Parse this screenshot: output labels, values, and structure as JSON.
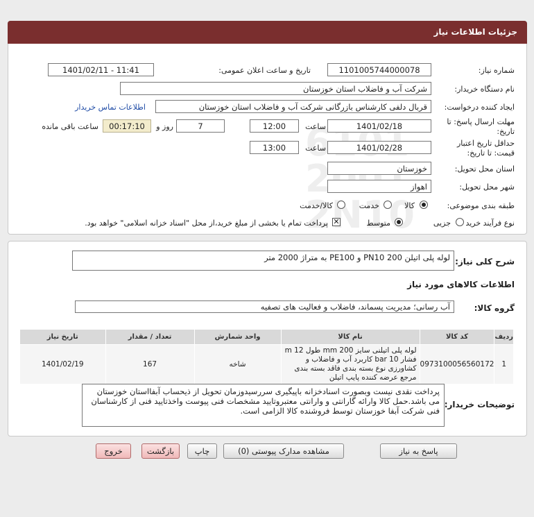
{
  "header": {
    "title": "جزئیات اطلاعات نیاز"
  },
  "form": {
    "need_number": {
      "label": "شماره نیاز:",
      "value": "1101005744000078"
    },
    "announce_datetime": {
      "label": "تاریخ و ساعت اعلان عمومی:",
      "value": "1401/02/11 - 11:41"
    },
    "buyer_org": {
      "label": "نام دستگاه خریدار:",
      "value": "شرکت آب و فاضلاب استان خوزستان"
    },
    "requester": {
      "label": "ایجاد کننده درخواست:",
      "value": "قربال دلفی کارشناس بازرگانی شرکت آب و فاضلاب استان خوزستان",
      "contact_link": "اطلاعات تماس خریدار"
    },
    "reply_deadline": {
      "label_line1": "مهلت ارسال پاسخ: تا",
      "label_line2": "تاریخ:",
      "date": "1401/02/18",
      "time_label": "ساعت",
      "time": "12:00",
      "days": "7",
      "days_label": "روز و",
      "remaining": "00:17:10",
      "remaining_label": "ساعت باقی مانده"
    },
    "price_validity": {
      "label_line1": "حداقل تاریخ اعتبار",
      "label_line2": "قیمت: تا تاریخ:",
      "date": "1401/02/28",
      "time_label": "ساعت",
      "time": "13:00"
    },
    "delivery_province": {
      "label": "استان محل تحویل:",
      "value": "خوزستان"
    },
    "delivery_city": {
      "label": "شهر محل تحویل:",
      "value": "اهواز"
    },
    "category": {
      "label": "طبقه بندی موضوعی:",
      "options": [
        "کالا",
        "خدمت",
        "کالا/خدمت"
      ],
      "selected": "کالا"
    },
    "purchase_process": {
      "label": "نوع فرآیند خرید :",
      "options": [
        "جزیی",
        "متوسط"
      ],
      "selected": "متوسط",
      "treasury_note": "پرداخت تمام یا بخشی از مبلغ خرید،از محل \"اسناد خزانه اسلامی\" خواهد بود."
    }
  },
  "general_desc": {
    "label": "شرح کلی نیاز:",
    "value": "لوله پلی اتیلن 200 PN10 و PE100 به متراژ 2000 متر"
  },
  "goods_info": {
    "title": "اطلاعات کالاهای مورد نیاز"
  },
  "goods_group": {
    "label": "گروه کالا:",
    "value": "آب رسانی؛ مدیریت پسماند، فاضلاب و فعالیت های تصفیه"
  },
  "table": {
    "headers": [
      "ردیف",
      "کد کالا",
      "نام کالا",
      "واحد شمارش",
      "تعداد / مقدار",
      "تاریخ نیاز"
    ],
    "rows": [
      {
        "row": "1",
        "code": "0973100056560172",
        "name": "لوله پلی اتیلنی سایز 200 mm طول 12 m فشار 10 bar کاربرد آب و فاضلاب و کشاورزی نوع بسته بندی فاقد بسته بندی مرجع عرضه کننده پایپ اتیلن",
        "unit": "شاخه",
        "qty": "167",
        "date": "1401/02/19"
      }
    ]
  },
  "buyer_notes": {
    "label": "توضیحات خریدار:",
    "value": "پرداخت نقدی نیست وبصورت اسنادخزانه باپیگیری سررسیدوزمان تحویل از ذیحساب آبفااستان خوزستان می باشد.حمل کالا وارائه گارانتی و وارانتی معتبروتایید مشخصات فنی پیوست واخذتایید فنی از کارشناسان فنی شرکت آبفا خوزستان توسط فروشنده کالا الزامی است."
  },
  "buttons": {
    "reply": "پاسخ به نیاز",
    "view_docs": "مشاهده مدارک پیوستی (0)",
    "print": "چاپ",
    "back": "بازگشت",
    "exit": "خروج"
  }
}
